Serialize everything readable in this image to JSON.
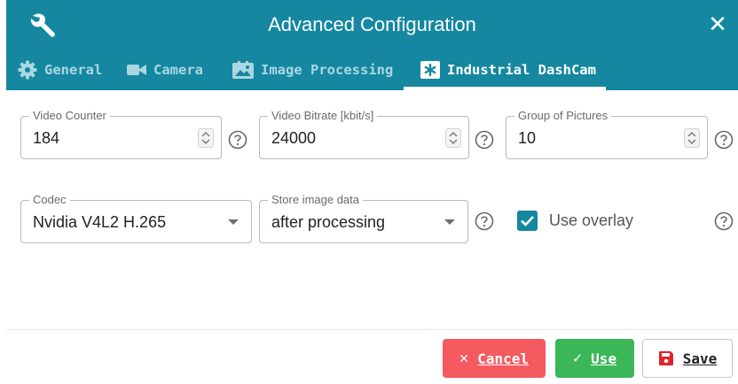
{
  "dialog": {
    "title": "Advanced Configuration",
    "close_icon": "close-icon"
  },
  "tabs": [
    {
      "label": "General",
      "icon": "gear-icon",
      "active": false
    },
    {
      "label": "Camera",
      "icon": "video-camera-icon",
      "active": false
    },
    {
      "label": "Image Processing",
      "icon": "image-icon",
      "active": false
    },
    {
      "label": "Industrial DashCam",
      "icon": "asterisk-box-icon",
      "active": true
    }
  ],
  "fields": {
    "video_counter": {
      "label": "Video Counter",
      "value": "184"
    },
    "video_bitrate": {
      "label": "Video Bitrate [kbit/s]",
      "value": "24000"
    },
    "group_of_pictures": {
      "label": "Group of Pictures",
      "value": "10"
    },
    "codec": {
      "label": "Codec",
      "value": "Nvidia V4L2 H.265"
    },
    "store_image_data": {
      "label": "Store image data",
      "value": "after processing"
    },
    "use_overlay": {
      "label": "Use overlay",
      "checked": true
    }
  },
  "buttons": {
    "cancel": "Cancel",
    "use": "Use",
    "save": "Save"
  },
  "colors": {
    "header": "#1587a0",
    "cancel": "#f45a5f",
    "use": "#3cb758",
    "save_icon": "#e0242c"
  }
}
